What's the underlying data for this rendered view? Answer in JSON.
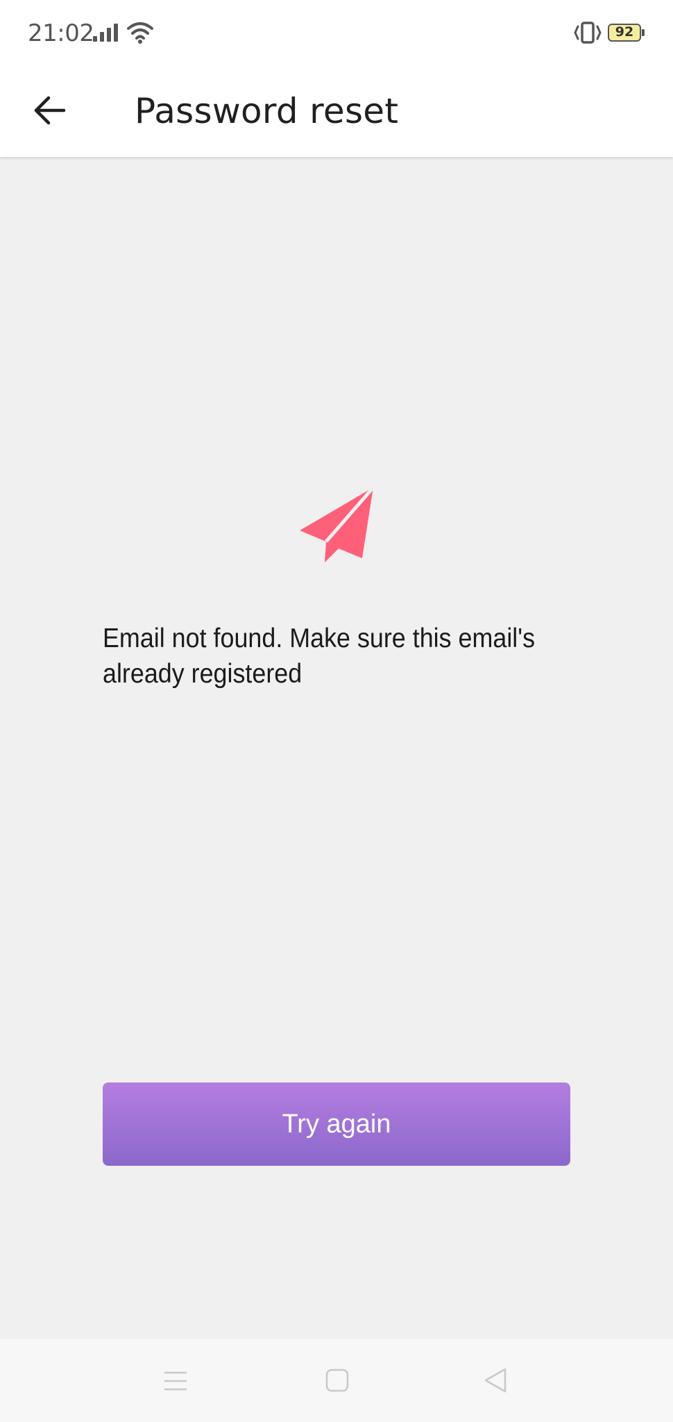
{
  "status_bar": {
    "time": "21:02",
    "battery_level": "92",
    "icons": [
      "signal-icon",
      "wifi-icon",
      "vibrate-icon",
      "battery-icon"
    ]
  },
  "app_bar": {
    "title": "Password reset",
    "back_icon": "arrow-left-icon"
  },
  "content": {
    "illustration_icon": "paper-plane-icon",
    "illustration_color": "#ff6079",
    "message": "Email not found. Make sure this email's already registered",
    "primary_button_label": "Try again",
    "button_gradient": [
      "#b57ee0",
      "#8b68cb"
    ]
  },
  "nav_bar": {
    "icons": [
      "menu-icon",
      "home-square-icon",
      "back-triangle-icon"
    ]
  }
}
